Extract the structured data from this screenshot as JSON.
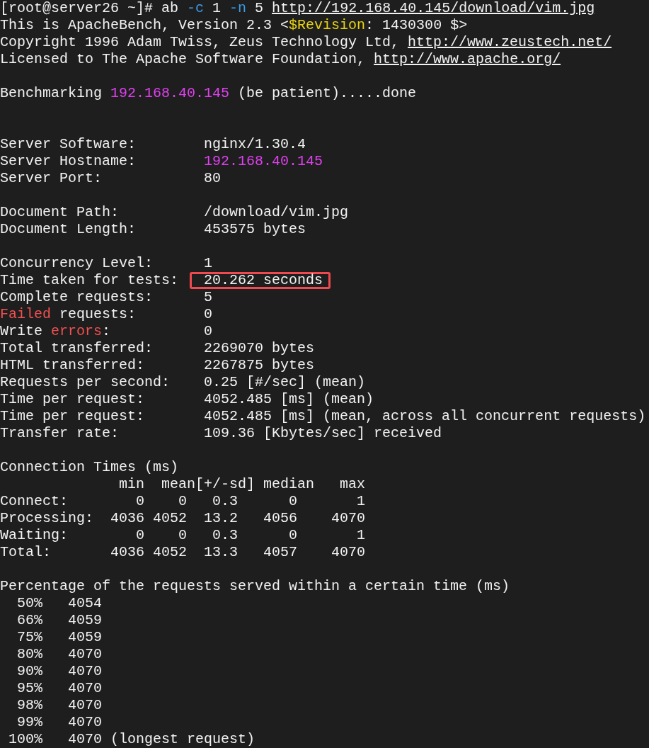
{
  "header": [
    {
      "segments": [
        {
          "kind": "plain",
          "text": "[root@server26 ~]# ab "
        },
        {
          "kind": "option",
          "text": "-c"
        },
        {
          "kind": "plain",
          "text": " 1 "
        },
        {
          "kind": "option",
          "text": "-n"
        },
        {
          "kind": "plain",
          "text": " 5 "
        },
        {
          "kind": "link",
          "text": "http://192.168.40.145/download/vim.jpg"
        }
      ]
    },
    {
      "segments": [
        {
          "kind": "plain",
          "text": "This is ApacheBench, Version 2.3 <"
        },
        {
          "kind": "keyword",
          "text": "$Revision"
        },
        {
          "kind": "plain",
          "text": ": 1430300 $>"
        }
      ]
    },
    {
      "segments": [
        {
          "kind": "plain",
          "text": "Copyright 1996 Adam Twiss, Zeus Technology Ltd, "
        },
        {
          "kind": "link",
          "text": "http://www.zeustech.net/"
        }
      ]
    },
    {
      "segments": [
        {
          "kind": "plain",
          "text": "Licensed to The Apache Software Foundation, "
        },
        {
          "kind": "link",
          "text": "http://www.apache.org/"
        }
      ]
    }
  ],
  "status": {
    "segments": [
      {
        "kind": "plain",
        "text": "Benchmarking "
      },
      {
        "kind": "address",
        "text": "192.168.40.145"
      },
      {
        "kind": "plain",
        "text": " (be patient).....done"
      }
    ]
  },
  "stats": [
    [
      {
        "label": [
          {
            "kind": "plain",
            "text": "Server Software:"
          }
        ],
        "value": [
          {
            "kind": "plain",
            "text": "nginx/1.30.4"
          }
        ],
        "highlighted": false
      },
      {
        "label": [
          {
            "kind": "plain",
            "text": "Server Hostname:"
          }
        ],
        "value": [
          {
            "kind": "address",
            "text": "192.168.40.145"
          }
        ],
        "highlighted": false
      },
      {
        "label": [
          {
            "kind": "plain",
            "text": "Server Port:"
          }
        ],
        "value": [
          {
            "kind": "plain",
            "text": "80"
          }
        ],
        "highlighted": false
      }
    ],
    [
      {
        "label": [
          {
            "kind": "plain",
            "text": "Document Path:"
          }
        ],
        "value": [
          {
            "kind": "plain",
            "text": "/download/vim.jpg"
          }
        ],
        "highlighted": false
      },
      {
        "label": [
          {
            "kind": "plain",
            "text": "Document Length:"
          }
        ],
        "value": [
          {
            "kind": "plain",
            "text": "453575 bytes"
          }
        ],
        "highlighted": false
      }
    ],
    [
      {
        "label": [
          {
            "kind": "plain",
            "text": "Concurrency Level:"
          }
        ],
        "value": [
          {
            "kind": "plain",
            "text": "1"
          }
        ],
        "highlighted": false
      },
      {
        "label": [
          {
            "kind": "plain",
            "text": "Time taken for tests:"
          }
        ],
        "value": [
          {
            "kind": "plain",
            "text": "20.262 seconds"
          }
        ],
        "highlighted": true
      },
      {
        "label": [
          {
            "kind": "plain",
            "text": "Complete requests:"
          }
        ],
        "value": [
          {
            "kind": "plain",
            "text": "5"
          }
        ],
        "highlighted": false
      },
      {
        "label": [
          {
            "kind": "error",
            "text": "Failed"
          },
          {
            "kind": "plain",
            "text": " requests:"
          }
        ],
        "value": [
          {
            "kind": "plain",
            "text": "0"
          }
        ],
        "highlighted": false
      },
      {
        "label": [
          {
            "kind": "plain",
            "text": "Write "
          },
          {
            "kind": "error",
            "text": "errors"
          },
          {
            "kind": "plain",
            "text": ":"
          }
        ],
        "value": [
          {
            "kind": "plain",
            "text": "0"
          }
        ],
        "highlighted": false
      },
      {
        "label": [
          {
            "kind": "plain",
            "text": "Total transferred:"
          }
        ],
        "value": [
          {
            "kind": "plain",
            "text": "2269070 bytes"
          }
        ],
        "highlighted": false
      },
      {
        "label": [
          {
            "kind": "plain",
            "text": "HTML transferred:"
          }
        ],
        "value": [
          {
            "kind": "plain",
            "text": "2267875 bytes"
          }
        ],
        "highlighted": false
      },
      {
        "label": [
          {
            "kind": "plain",
            "text": "Requests per second:"
          }
        ],
        "value": [
          {
            "kind": "plain",
            "text": "0.25 [#/sec] (mean)"
          }
        ],
        "highlighted": false
      },
      {
        "label": [
          {
            "kind": "plain",
            "text": "Time per request:"
          }
        ],
        "value": [
          {
            "kind": "plain",
            "text": "4052.485 [ms] (mean)"
          }
        ],
        "highlighted": false
      },
      {
        "label": [
          {
            "kind": "plain",
            "text": "Time per request:"
          }
        ],
        "value": [
          {
            "kind": "plain",
            "text": "4052.485 [ms] (mean, across all concurrent requests)"
          }
        ],
        "highlighted": false
      },
      {
        "label": [
          {
            "kind": "plain",
            "text": "Transfer rate:"
          }
        ],
        "value": [
          {
            "kind": "plain",
            "text": "109.36 [Kbytes/sec] received"
          }
        ],
        "highlighted": false
      }
    ]
  ],
  "connection_times": {
    "title": "Connection Times (ms)",
    "columns": [
      "min",
      "mean[+/-sd]",
      "median",
      "max"
    ],
    "rows": [
      {
        "name": "Connect:",
        "values": [
          "0",
          "0",
          "0.3",
          "0",
          "1"
        ]
      },
      {
        "name": "Processing:",
        "values": [
          "4036",
          "4052",
          "13.2",
          "4056",
          "4070"
        ]
      },
      {
        "name": "Waiting:",
        "values": [
          "0",
          "0",
          "0.3",
          "0",
          "1"
        ]
      },
      {
        "name": "Total:",
        "values": [
          "4036",
          "4052",
          "13.3",
          "4057",
          "4070"
        ]
      }
    ]
  },
  "percentiles": {
    "title": "Percentage of the requests served within a certain time (ms)",
    "rows": [
      {
        "percent": "50%",
        "time": "4054"
      },
      {
        "percent": "66%",
        "time": "4059"
      },
      {
        "percent": "75%",
        "time": "4059"
      },
      {
        "percent": "80%",
        "time": "4070"
      },
      {
        "percent": "90%",
        "time": "4070"
      },
      {
        "percent": "95%",
        "time": "4070"
      },
      {
        "percent": "98%",
        "time": "4070"
      },
      {
        "percent": "99%",
        "time": "4070"
      },
      {
        "percent": "100%",
        "time": "4070",
        "note": "(longest request)"
      }
    ]
  }
}
